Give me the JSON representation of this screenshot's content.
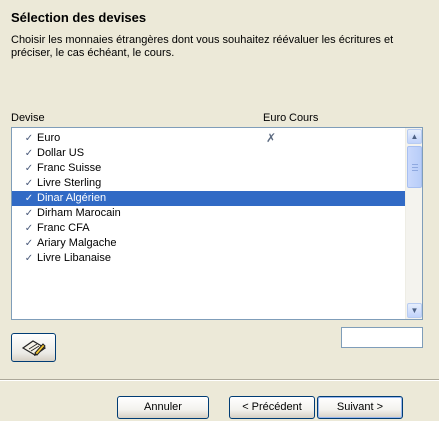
{
  "header": {
    "title": "Sélection des devises",
    "description": "Choisir les monnaies étrangères dont vous souhaitez réévaluer les écritures et préciser, le cas échéant, le cours."
  },
  "columns": {
    "devise": "Devise",
    "euro": "Euro",
    "cours": "Cours"
  },
  "currencies": [
    {
      "name": "Euro",
      "checked": true,
      "euro": "✗",
      "selected": false
    },
    {
      "name": "Dollar US",
      "checked": true,
      "euro": "",
      "selected": false
    },
    {
      "name": "Franc Suisse",
      "checked": true,
      "euro": "",
      "selected": false
    },
    {
      "name": "Livre Sterling",
      "checked": true,
      "euro": "",
      "selected": false
    },
    {
      "name": "Dinar Algérien",
      "checked": true,
      "euro": "",
      "selected": true
    },
    {
      "name": "Dirham Marocain",
      "checked": true,
      "euro": "",
      "selected": false
    },
    {
      "name": "Franc CFA",
      "checked": true,
      "euro": "",
      "selected": false
    },
    {
      "name": "Ariary Malgache",
      "checked": true,
      "euro": "",
      "selected": false
    },
    {
      "name": "Livre Libanaise",
      "checked": true,
      "euro": "",
      "selected": false
    }
  ],
  "cours_input": {
    "value": ""
  },
  "icons": {
    "check": "check-icon",
    "euro_cross": "cross-icon",
    "tool": "paper-pencil-icon"
  },
  "buttons": {
    "cancel": "Annuler",
    "previous": "< Précédent",
    "next": "Suivant >"
  },
  "colors": {
    "selection": "#316ac5",
    "dialog_bg": "#ece9d8",
    "border": "#7f9db9"
  }
}
